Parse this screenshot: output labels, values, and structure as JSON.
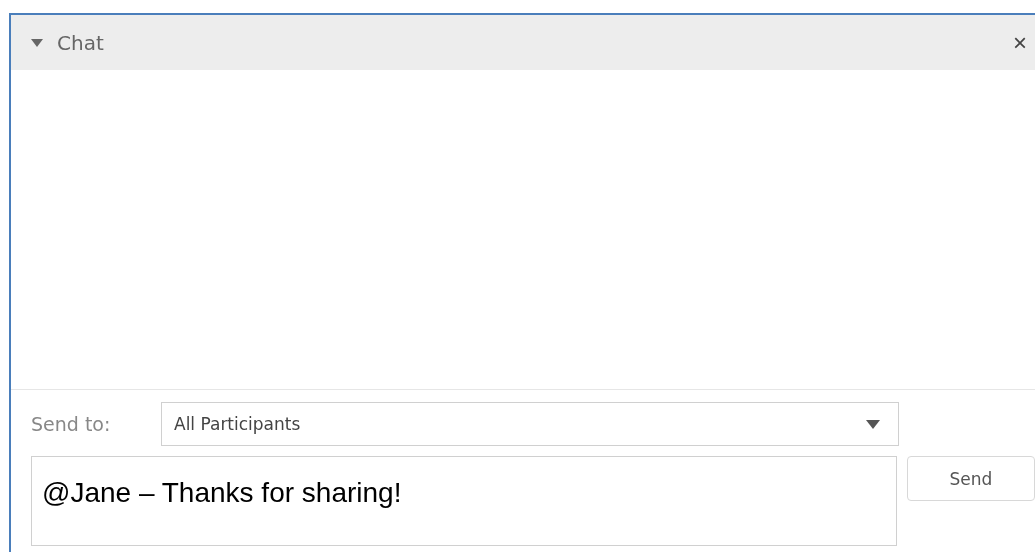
{
  "panel": {
    "title": "Chat",
    "expanded": true,
    "close": "×"
  },
  "send_to": {
    "label": "Send to:",
    "value": "All Participants"
  },
  "message": {
    "value": "@Jane – Thanks for sharing!"
  },
  "send_button": "Send"
}
